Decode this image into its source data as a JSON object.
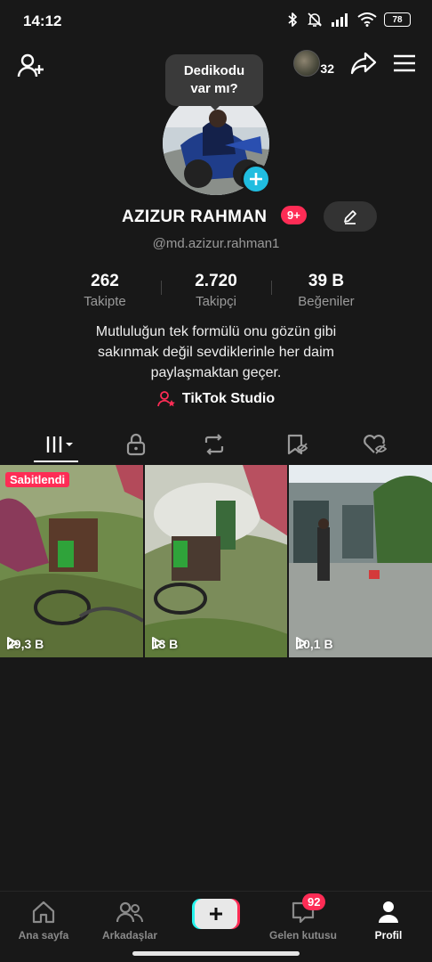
{
  "status_bar": {
    "time": "14:12",
    "battery": "78"
  },
  "header": {
    "viewer_count": "32"
  },
  "bubble": {
    "line1": "Dedikodu",
    "line2": "var mı?"
  },
  "profile": {
    "name": "AZIZUR RAHMAN",
    "badge": "9+",
    "username": "@md.azizur.rahman1",
    "bio_lines": [
      "Mutluluğun tek formülü onu gözün gibi",
      "sakınmak değil sevdiklerinle her daim",
      "paylaşmaktan geçer."
    ],
    "studio_link": "TikTok Studio"
  },
  "stats": [
    {
      "value": "262",
      "label": "Takipte"
    },
    {
      "value": "2.720",
      "label": "Takipçi"
    },
    {
      "value": "39 B",
      "label": "Beğeniler"
    }
  ],
  "tabs": [
    {
      "icon": "grid-icon",
      "active": true
    },
    {
      "icon": "lock-icon",
      "active": false
    },
    {
      "icon": "repost-icon",
      "active": false
    },
    {
      "icon": "favorites-icon",
      "active": false
    },
    {
      "icon": "liked-icon",
      "active": false
    }
  ],
  "videos": [
    {
      "views": "29,3 B",
      "pinned_label": "Sabitlendi"
    },
    {
      "views": "13 B"
    },
    {
      "views": "10,1 B"
    }
  ],
  "bottom_nav": {
    "home": "Ana sayfa",
    "friends": "Arkadaşlar",
    "inbox": "Gelen kutusu",
    "inbox_badge": "92",
    "profile": "Profil"
  },
  "colors": {
    "background": "#181818",
    "accent": "#fe2c55",
    "plus_badge": "#20bde0"
  }
}
